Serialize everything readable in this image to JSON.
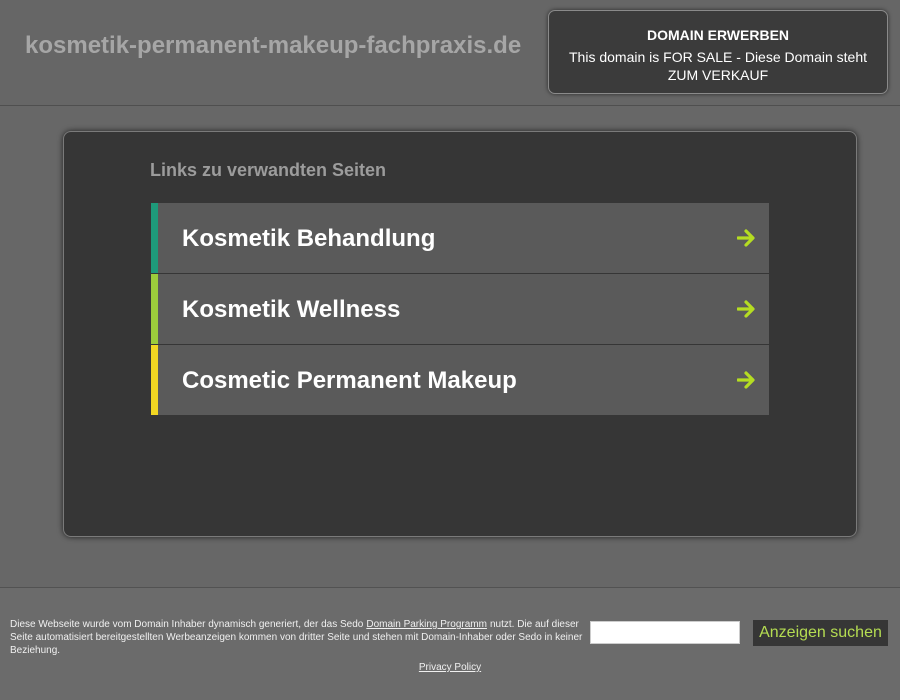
{
  "header": {
    "domain": "kosmetik-permanent-makeup-fachpraxis.de",
    "sale": {
      "title": "DOMAIN ERWERBEN",
      "text": "This domain is FOR SALE - Diese Domain steht ZUM VERKAUF"
    }
  },
  "main": {
    "heading": "Links zu verwandten Seiten",
    "links": [
      {
        "label": "Kosmetik Behandlung",
        "accent": "#1e9a7a"
      },
      {
        "label": "Kosmetik Wellness",
        "accent": "#9ccc3c"
      },
      {
        "label": "Cosmetic Permanent Makeup",
        "accent": "#f2d722"
      }
    ],
    "arrow_icon": "arrow-right-icon",
    "arrow_color": "#b5dd22"
  },
  "footer": {
    "disclaimer_pre": "Diese Webseite wurde vom Domain Inhaber dynamisch generiert, der das Sedo",
    "disclaimer_link": "Domain Parking Programm",
    "disclaimer_post": "nutzt. Die auf dieser Seite automatisiert bereitgestellten Werbeanzeigen kommen von dritter Seite und stehen mit Domain-Inhaber oder Sedo in keiner Beziehung.",
    "search_value": "",
    "search_button": "Anzeigen suchen",
    "privacy": "Privacy Policy"
  }
}
